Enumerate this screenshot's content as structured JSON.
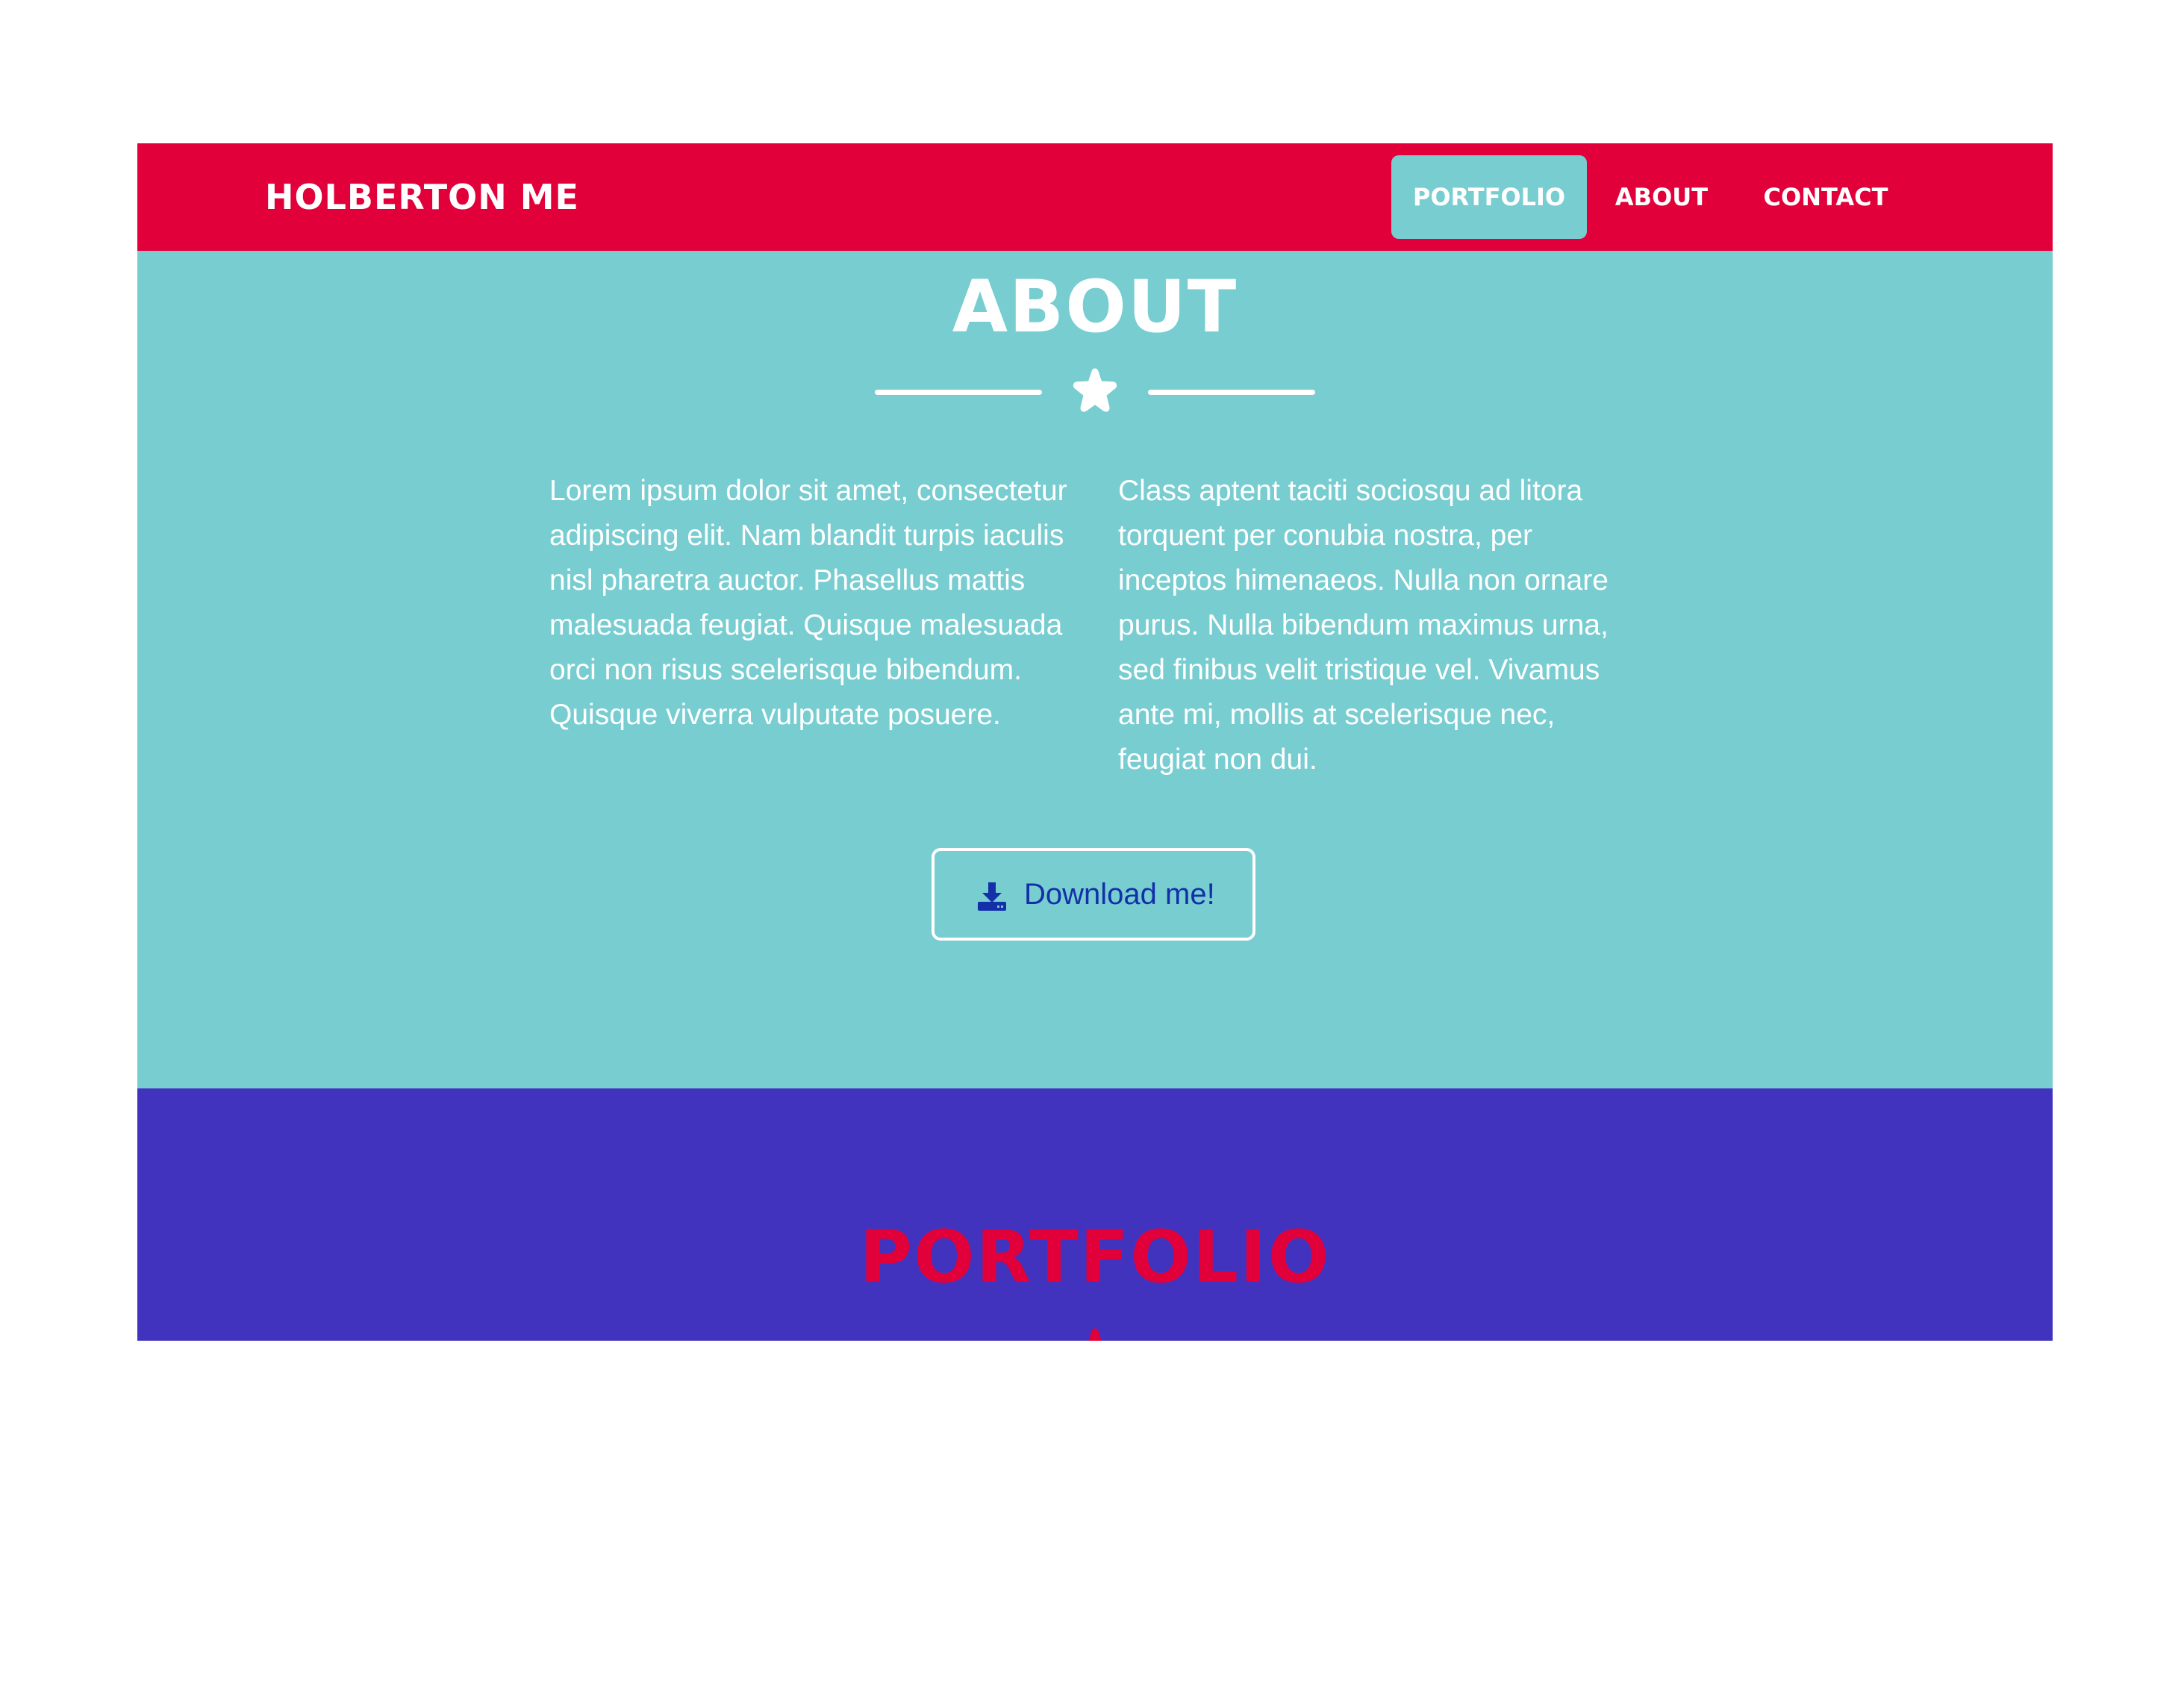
{
  "navbar": {
    "brand": "HOLBERTON ME",
    "links": [
      {
        "label": "PORTFOLIO",
        "active": true
      },
      {
        "label": "ABOUT",
        "active": false
      },
      {
        "label": "CONTACT",
        "active": false
      }
    ]
  },
  "about": {
    "title": "ABOUT",
    "divider_icon": "star-icon",
    "paragraph_left": "Lorem ipsum dolor sit amet, consectetur adipiscing elit. Nam blandit turpis iaculis nisl pharetra auctor. Phasellus mattis malesuada feugiat. Quisque malesuada orci non risus scelerisque bibendum. Quisque viverra vulputate posuere.",
    "paragraph_right": "Class aptent taciti sociosqu ad litora torquent per conubia nostra, per inceptos himenaeos. Nulla non ornare purus. Nulla bibendum maximus urna, sed finibus velit tristique vel. Vivamus ante mi, mollis at scelerisque nec, feugiat non dui.",
    "download_button": {
      "label": "Download me!",
      "icon": "download-icon"
    }
  },
  "portfolio": {
    "title": "PORTFOLIO",
    "divider_icon": "star-icon"
  },
  "colors": {
    "navbar_bg": "#e1003a",
    "about_bg": "#78cdd1",
    "portfolio_bg": "#4233bf",
    "portfolio_title": "#e1003a",
    "download_text": "#1330a8",
    "active_nav_bg": "#78cdd1"
  }
}
